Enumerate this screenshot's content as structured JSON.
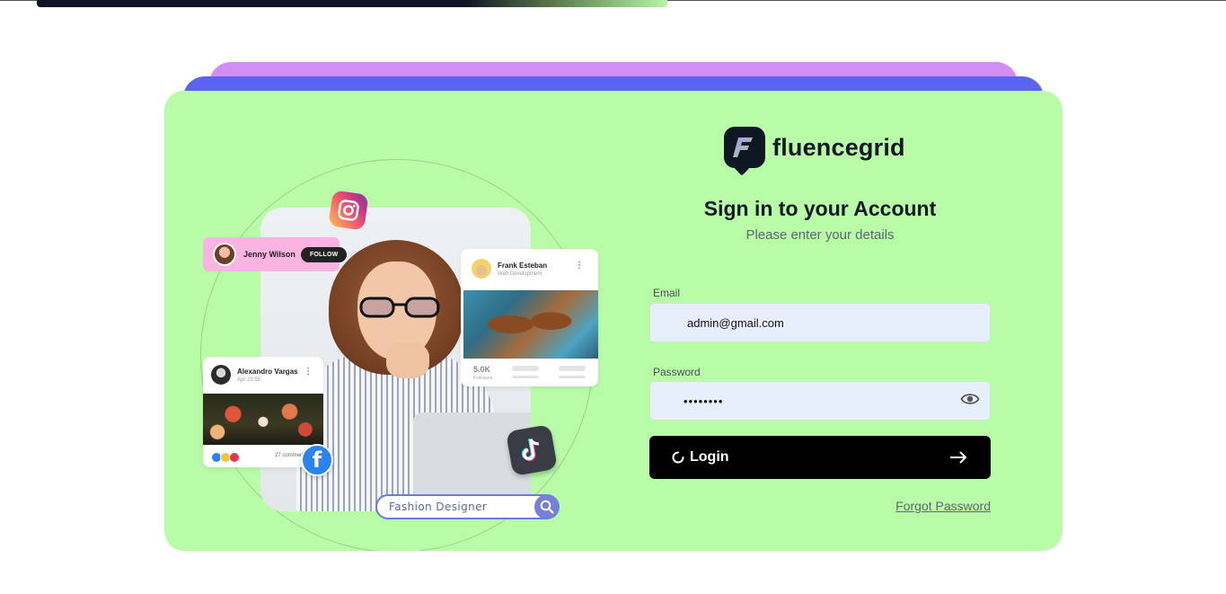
{
  "page": {
    "progress": 0.54
  },
  "brand": {
    "name": "fluencegrid",
    "logo_letter": "F"
  },
  "form": {
    "title": "Sign in to your Account",
    "subtitle": "Please enter your details",
    "email_label": "Email",
    "email_value": "admin@gmail.com",
    "password_label": "Password",
    "password_value": "••••••••",
    "login_label": "Login",
    "forgot_label": "Forgot Password"
  },
  "illustration": {
    "jenny": {
      "name": "Jenny Wilson",
      "follow": "FOLLOW"
    },
    "frank": {
      "name": "Frank Esteban",
      "role": "Web Development",
      "followers_count": "5.0K",
      "followers_label": "Followers"
    },
    "alexandro": {
      "name": "Alexandro Vargas",
      "time": "Apr 23:55",
      "comments": "27 comments"
    },
    "search_chip": "Fashion Designer",
    "icons": [
      "instagram-icon",
      "facebook-icon",
      "tiktok-icon",
      "search-icon"
    ]
  },
  "colors": {
    "card_bg": "#b8fca8",
    "stack_purple": "#d18cf5",
    "stack_blue": "#5a63f2",
    "input_bg": "#e8effc",
    "button_bg": "#000000",
    "brand_dark": "#0e1722"
  }
}
